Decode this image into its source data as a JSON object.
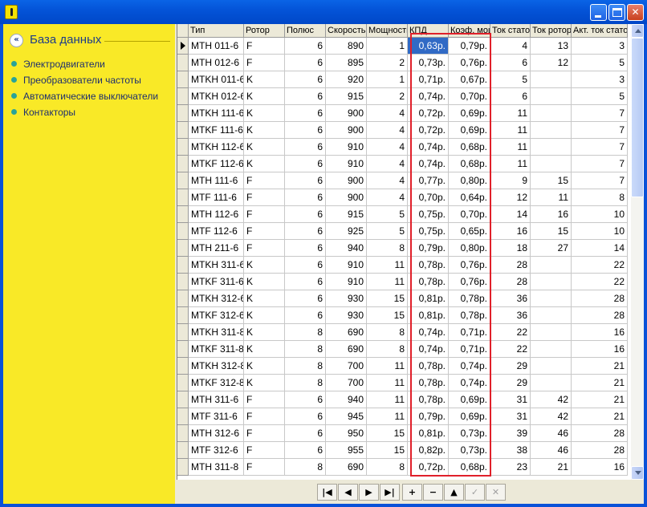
{
  "window": {
    "title": "",
    "controls": {
      "minimize": "",
      "maximize": "",
      "close": "✕"
    }
  },
  "sidebar": {
    "title": "База данных",
    "items": [
      {
        "label": "Электродвигатели"
      },
      {
        "label": "Преобразователи частоты"
      },
      {
        "label": "Автоматические выключатели"
      },
      {
        "label": "Контакторы"
      }
    ]
  },
  "grid": {
    "columns": [
      "Тип",
      "Ротор",
      "Полюс",
      "Скорость",
      "Мощность",
      "КПД",
      "Коэф. мощности",
      "Ток статора",
      "Ток ротора",
      "Акт. ток статора"
    ],
    "selected_cell": {
      "row": 0,
      "column": 5
    },
    "highlight_column_label": "КПД",
    "rows": [
      [
        "MTH 011-6",
        "F",
        "6",
        "890",
        "1",
        "0,63р.",
        "0,79р.",
        "4",
        "13",
        "3"
      ],
      [
        "MTH 012-6",
        "F",
        "6",
        "895",
        "2",
        "0,73р.",
        "0,76р.",
        "6",
        "12",
        "5"
      ],
      [
        "MTKH 011-6",
        "K",
        "6",
        "920",
        "1",
        "0,71р.",
        "0,67р.",
        "5",
        "",
        "3"
      ],
      [
        "MTKH 012-6",
        "K",
        "6",
        "915",
        "2",
        "0,74р.",
        "0,70р.",
        "6",
        "",
        "5"
      ],
      [
        "MTKH 111-6",
        "K",
        "6",
        "900",
        "4",
        "0,72р.",
        "0,69р.",
        "11",
        "",
        "7"
      ],
      [
        "MTKF 111-6",
        "K",
        "6",
        "900",
        "4",
        "0,72р.",
        "0,69р.",
        "11",
        "",
        "7"
      ],
      [
        "MTKH 112-6",
        "K",
        "6",
        "910",
        "4",
        "0,74р.",
        "0,68р.",
        "11",
        "",
        "7"
      ],
      [
        "MTKF 112-6",
        "K",
        "6",
        "910",
        "4",
        "0,74р.",
        "0,68р.",
        "11",
        "",
        "7"
      ],
      [
        "MTH 111-6",
        "F",
        "6",
        "900",
        "4",
        "0,77р.",
        "0,80р.",
        "9",
        "15",
        "7"
      ],
      [
        "MTF 111-6",
        "F",
        "6",
        "900",
        "4",
        "0,70р.",
        "0,64р.",
        "12",
        "11",
        "8"
      ],
      [
        "MTH 112-6",
        "F",
        "6",
        "915",
        "5",
        "0,75р.",
        "0,70р.",
        "14",
        "16",
        "10"
      ],
      [
        "MTF 112-6",
        "F",
        "6",
        "925",
        "5",
        "0,75р.",
        "0,65р.",
        "16",
        "15",
        "10"
      ],
      [
        "MTH 211-6",
        "F",
        "6",
        "940",
        "8",
        "0,79р.",
        "0,80р.",
        "18",
        "27",
        "14"
      ],
      [
        "MTKH 311-6",
        "K",
        "6",
        "910",
        "11",
        "0,78р.",
        "0,76р.",
        "28",
        "",
        "22"
      ],
      [
        "MTKF 311-6",
        "K",
        "6",
        "910",
        "11",
        "0,78р.",
        "0,76р.",
        "28",
        "",
        "22"
      ],
      [
        "MTKH 312-6",
        "K",
        "6",
        "930",
        "15",
        "0,81р.",
        "0,78р.",
        "36",
        "",
        "28"
      ],
      [
        "MTKF 312-6",
        "K",
        "6",
        "930",
        "15",
        "0,81р.",
        "0,78р.",
        "36",
        "",
        "28"
      ],
      [
        "MTKH 311-8",
        "K",
        "8",
        "690",
        "8",
        "0,74р.",
        "0,71р.",
        "22",
        "",
        "16"
      ],
      [
        "MTKF 311-8",
        "K",
        "8",
        "690",
        "8",
        "0,74р.",
        "0,71р.",
        "22",
        "",
        "16"
      ],
      [
        "MTKH 312-8",
        "K",
        "8",
        "700",
        "11",
        "0,78р.",
        "0,74р.",
        "29",
        "",
        "21"
      ],
      [
        "MTKF 312-8",
        "K",
        "8",
        "700",
        "11",
        "0,78р.",
        "0,74р.",
        "29",
        "",
        "21"
      ],
      [
        "MTH 311-6",
        "F",
        "6",
        "940",
        "11",
        "0,78р.",
        "0,69р.",
        "31",
        "42",
        "21"
      ],
      [
        "MTF 311-6",
        "F",
        "6",
        "945",
        "11",
        "0,79р.",
        "0,69р.",
        "31",
        "42",
        "21"
      ],
      [
        "MTH 312-6",
        "F",
        "6",
        "950",
        "15",
        "0,81р.",
        "0,73р.",
        "39",
        "46",
        "28"
      ],
      [
        "MTF 312-6",
        "F",
        "6",
        "955",
        "15",
        "0,82р.",
        "0,73р.",
        "38",
        "46",
        "28"
      ],
      [
        "MTH 311-8",
        "F",
        "8",
        "690",
        "8",
        "0,72р.",
        "0,68р.",
        "23",
        "21",
        "16"
      ]
    ]
  },
  "navigator": {
    "buttons": [
      {
        "name": "first-record-button",
        "glyph": "|◀",
        "enabled": true
      },
      {
        "name": "prior-record-button",
        "glyph": "◀",
        "enabled": true
      },
      {
        "name": "next-record-button",
        "glyph": "▶",
        "enabled": true
      },
      {
        "name": "last-record-button",
        "glyph": "▶|",
        "enabled": true
      },
      {
        "name": "insert-record-button",
        "glyph": "+",
        "enabled": true
      },
      {
        "name": "delete-record-button",
        "glyph": "−",
        "enabled": true
      },
      {
        "name": "edit-record-button",
        "glyph": "▲",
        "enabled": true
      },
      {
        "name": "post-edit-button",
        "glyph": "✓",
        "enabled": false
      },
      {
        "name": "cancel-edit-button",
        "glyph": "✕",
        "enabled": false
      }
    ]
  },
  "colors": {
    "sidebar_bg": "#F9E927",
    "selection": "#316AC5",
    "highlight_border": "#E0202A",
    "titlebar": "#0454D8"
  }
}
